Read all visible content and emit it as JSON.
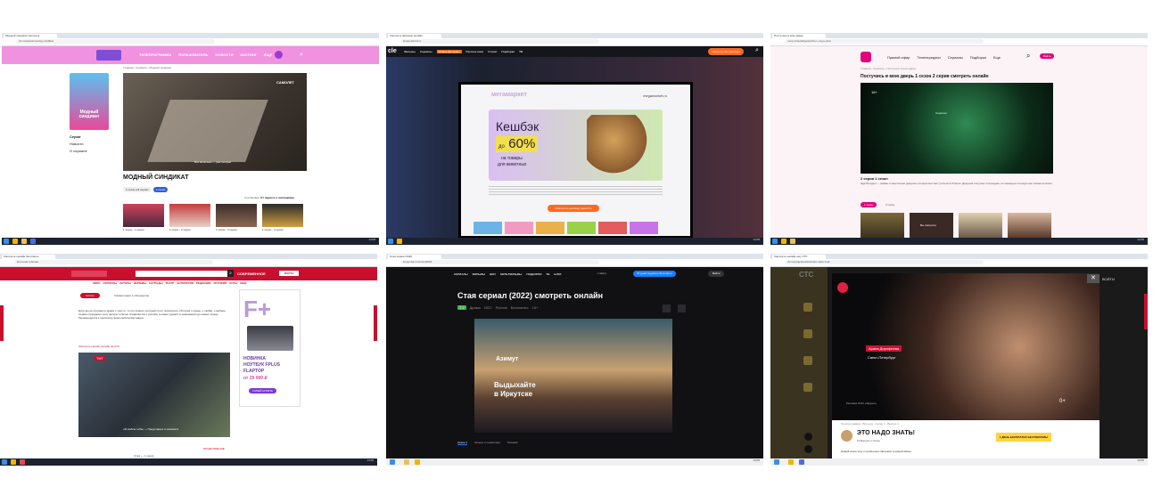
{
  "panels": {
    "p1": {
      "tab": "Модный синдикат смотреть",
      "url": "ctc.ru/series/modnyy-sindikat",
      "nav": [
        "ТЕЛЕПРОГРАММА",
        "ПОЛЬЗОВАТЕЛЬ",
        "НОВОСТИ",
        "КАСТИНГ",
        "ЕЩЕ"
      ],
      "breadcrumb": "Главная › Сериалы › Модный синдикат",
      "poster_title": "Модный синдикат",
      "sidebar": [
        "Серии",
        "Новости",
        "О сериале"
      ],
      "video_badge": "САМОЛЕТ",
      "video_caption": "Все включено — уже сегодня",
      "title": "МОДНЫЙ СИНДИКАТ",
      "tag1": "1 сезон в 8 сериях",
      "tag2": "1 сезон",
      "sort_label": "Сортировка:",
      "sort_value": "От первого к последнему",
      "episodes": [
        "1 сезон - 1 серия",
        "1 сезон - 2 серия",
        "1 сезон - 3 серия",
        "1 сезон - 4 серия"
      ]
    },
    "p2": {
      "tab": "Смотреть фильмы онлайн",
      "url": "kinopoisk-hd.ru",
      "nav": [
        "Фильмы",
        "Сериалы",
        "Новые фильмы",
        "Русское кино",
        "О кино",
        "Подборки",
        "ТВ"
      ],
      "ad_logo": "мегамаркет",
      "ad_brand": "megamarket.ru",
      "ad_headline": "Кешбэк",
      "ad_percent": "60%",
      "ad_prefix": "до",
      "ad_sub1": "на товары",
      "ad_sub2": "для животных",
      "ad_button": "Отключить рекламу через 5 с",
      "header_button": "Смотреть без рекламы"
    },
    "p3": {
      "tab": "Постучись в мою дверь",
      "url": "more.tv/serial/postuchis-v-moyu-dver",
      "nav": [
        "Прямой эфир",
        "Телепередачи",
        "Сериалы",
        "Подборки",
        "Еще"
      ],
      "login": "Войти",
      "breadcrumb": "Главная › Сериалы › Постучись в мою дверь",
      "title": "Постучись в мою дверь 1 сезон 2 серия смотреть онлайн",
      "video_label": "Сериалы",
      "episode_title": "2 серия 1 сезон",
      "desc": "Эда Йылдыз — живая и энергичная девушка, которая мечтает учиться в Италии. Девушка получает стипендию, но накануне отъезда она лишается всего.",
      "tab_active": "1 сезон",
      "tab_other": "2 сезон",
      "thumb_label": "Вы смотрите",
      "age": "16+"
    },
    "p4": {
      "tab": "Смотреть онлайн бесплатно",
      "url": "kino-teatr.ru/serial",
      "search_button": "СОВРЕМЕННОЕ",
      "login": "ВОЙТИ",
      "nav": [
        "КИНО",
        "СЕРИАЛЫ",
        "АКТЕРЫ",
        "ФИЛЬМЫ",
        "НАГРАДЫ",
        "ТЕАТР",
        "АНТОЛОГИЯ",
        "РЕЦЕНЗИИ",
        "ИСТОРИЯ",
        "НОТЫ",
        "ЕЩЕ"
      ],
      "tab_active": "Читать",
      "tab_other": "Комментарии и обсуждения",
      "body": "Если вы не отрицаете драму с чем-то, то это сериал, который стоит посмотреть. История о семье, о любви, о выборе. Сериал прекрасно снят, актеры отлично справляются с ролями, а сюжет держит в напряжении до самого конца. Рекомендуется к просмотру всем любителям жанра.",
      "link": "Смотреть сериал онлайн на СТС",
      "photo_brand": "ТНТ",
      "photo_caption": "«Я люблю тебя» — Представьте и напишите",
      "ad_brand": "F+",
      "ad_title1": "НОВИНКА",
      "ad_title2": "НОУТБУК FPLUS",
      "ad_title3": "FLAPTOP",
      "ad_price": "от 29 999 ₽",
      "ad_button": "УСПЕЙ КУПИТЬ",
      "more_link": "ПРОДОЛЖЕНИЕ",
      "footer": "Стаж — 1 серия"
    },
    "p5": {
      "tab": "Стая сериал 2022",
      "url": "kinopoisk.ru/series/2022",
      "nav": [
        "СЕРИАЛЫ",
        "ФИЛЬМЫ",
        "ШОУ",
        "МУЛЬТФИЛЬМЫ",
        "ПОДБОРКИ",
        "ТВ",
        "БЛОГ"
      ],
      "search": "Найти",
      "promo": "30 дней подписки бесплатно",
      "login": "Войти",
      "title": "Стая сериал (2022) смотреть онлайн",
      "rating": "7.2",
      "meta": [
        "Драма",
        "2022",
        "Россия",
        "Бесплатно",
        "16+"
      ],
      "ad_brand": "Азимут",
      "ad_line1": "Выдыхайте",
      "ad_line2": "в Иркутске",
      "tabs": [
        "Сезон 1",
        "Актеры и съемочная",
        "Похожие"
      ]
    },
    "p6": {
      "tab": "Смотреть онлайн шоу СТС",
      "url": "ctc.ru/projects/shows/eto-nado-znat",
      "brand": "СТС",
      "exit": "ВОЙТИ",
      "video_name": "Арина Дорофеева",
      "video_place": "Санкт-Петербург",
      "video_age": "0+",
      "video_credit": "Реклама ООО «Яндекс»",
      "breadcrumb": "Телепрограмма › Все шоу › Сезон 1 › Выпуск 1",
      "show_title": "ЭТО НАДО ЗНАТЬ!",
      "show_sub": "10 Выпуск 1 Сезон",
      "cta": "1 ДЕНЬ БЕСПЛАТНО БЕЗ РЕКЛАМЫ",
      "desc": "Новый сезон шоу о необычных явлениях в нашей жизни"
    }
  },
  "taskbar": {
    "time": "13:05",
    "date": "14.02.2023"
  },
  "colors": {
    "ctc_pink": "#f092e0",
    "accent_orange": "#ff6a1f",
    "dark_bg": "#111114",
    "red": "#c8102e",
    "more_red": "#e6007e",
    "promo_blue": "#1e7cff",
    "yellow": "#ffd23f"
  }
}
